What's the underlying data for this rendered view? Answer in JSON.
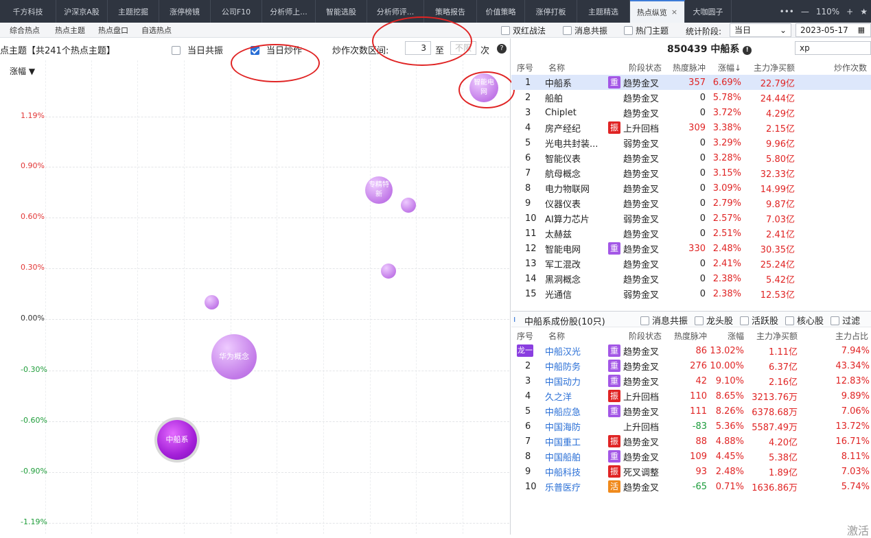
{
  "top_tabs": [
    {
      "label": "千方科技",
      "active": false
    },
    {
      "label": "沪深京A股",
      "active": false
    },
    {
      "label": "主题挖掘",
      "active": false
    },
    {
      "label": "涨停榜镜",
      "active": false
    },
    {
      "label": "公司F10",
      "active": false
    },
    {
      "label": "分析师上...",
      "active": false
    },
    {
      "label": "智能选股",
      "active": false
    },
    {
      "label": "分析师评...",
      "active": false
    },
    {
      "label": "策略报告",
      "active": false
    },
    {
      "label": "价值策略",
      "active": false
    },
    {
      "label": "涨停打板",
      "active": false
    },
    {
      "label": "主题精选",
      "active": false
    },
    {
      "label": "热点纵览",
      "active": true
    },
    {
      "label": "大咖圆子",
      "active": false
    }
  ],
  "window_controls": {
    "more": "•••",
    "minus": "—",
    "zoom": "110%",
    "plus": "+",
    "star": "★"
  },
  "sub_tabs": [
    {
      "label": "综合热点",
      "active": true
    },
    {
      "label": "热点主题",
      "active": false
    },
    {
      "label": "热点盘口",
      "active": false
    },
    {
      "label": "自选热点",
      "active": false
    }
  ],
  "filters": {
    "shuanghong": "双红战法",
    "xiaoxi_gongzhen": "消息共振",
    "remen_zhuti": "热门主题",
    "period_label": "统计阶段:",
    "period_value": "当日",
    "date_value": "2023-05-17"
  },
  "left": {
    "header_title": "点主题【共241个热点主题】",
    "same_day_resonance": "当日共振",
    "same_day_trade": "当日炒作",
    "trade_count_label": "炒作次数区间:",
    "count_from": "3",
    "count_to_word": "至",
    "count_to_placeholder": "不限",
    "count_unit": "次",
    "sort_label": "涨幅",
    "yticks": [
      "1.19%",
      "0.90%",
      "0.60%",
      "0.30%",
      "0.00%",
      "-0.30%",
      "-0.60%",
      "-0.90%",
      "-1.19%"
    ],
    "bubbles": [
      {
        "label": "智能电网"
      },
      {
        "label": "专精特新"
      },
      {
        "label": ""
      },
      {
        "label": ""
      },
      {
        "label": ""
      },
      {
        "label": "华为概念"
      },
      {
        "label": "中船系"
      }
    ]
  },
  "right": {
    "stock_title": "850439 中船系",
    "search_value": "xp",
    "theme_headers": [
      "序号",
      "名称",
      "阶段状态",
      "热度脉冲",
      "涨幅↓",
      "主力净买额",
      "炒作次数"
    ],
    "themes": [
      {
        "no": "1",
        "name": "中船系",
        "tag": "重",
        "status": "趋势金叉",
        "heat": "357",
        "chg": "6.69%",
        "net": "22.79亿"
      },
      {
        "no": "2",
        "name": "船舶",
        "tag": "",
        "status": "趋势金叉",
        "heat": "0",
        "chg": "5.78%",
        "net": "24.44亿"
      },
      {
        "no": "3",
        "name": "Chiplet",
        "tag": "",
        "status": "趋势金叉",
        "heat": "0",
        "chg": "3.72%",
        "net": "4.29亿"
      },
      {
        "no": "4",
        "name": "房产经纪",
        "tag": "振",
        "status": "上升回档",
        "heat": "309",
        "chg": "3.38%",
        "net": "2.15亿"
      },
      {
        "no": "5",
        "name": "光电共封装...",
        "tag": "",
        "status": "弱势金叉",
        "heat": "0",
        "chg": "3.29%",
        "net": "9.96亿"
      },
      {
        "no": "6",
        "name": "智能仪表",
        "tag": "",
        "status": "趋势金叉",
        "heat": "0",
        "chg": "3.28%",
        "net": "5.80亿"
      },
      {
        "no": "7",
        "name": "航母概念",
        "tag": "",
        "status": "趋势金叉",
        "heat": "0",
        "chg": "3.15%",
        "net": "32.33亿"
      },
      {
        "no": "8",
        "name": "电力物联网",
        "tag": "",
        "status": "趋势金叉",
        "heat": "0",
        "chg": "3.09%",
        "net": "14.99亿"
      },
      {
        "no": "9",
        "name": "仪器仪表",
        "tag": "",
        "status": "趋势金叉",
        "heat": "0",
        "chg": "2.79%",
        "net": "9.87亿"
      },
      {
        "no": "10",
        "name": "AI算力芯片",
        "tag": "",
        "status": "弱势金叉",
        "heat": "0",
        "chg": "2.57%",
        "net": "7.03亿"
      },
      {
        "no": "11",
        "name": "太赫兹",
        "tag": "",
        "status": "趋势金叉",
        "heat": "0",
        "chg": "2.51%",
        "net": "2.41亿"
      },
      {
        "no": "12",
        "name": "智能电网",
        "tag": "重",
        "status": "趋势金叉",
        "heat": "330",
        "chg": "2.48%",
        "net": "30.35亿"
      },
      {
        "no": "13",
        "name": "军工混改",
        "tag": "",
        "status": "趋势金叉",
        "heat": "0",
        "chg": "2.41%",
        "net": "25.24亿"
      },
      {
        "no": "14",
        "name": "黑洞概念",
        "tag": "",
        "status": "趋势金叉",
        "heat": "0",
        "chg": "2.38%",
        "net": "5.42亿"
      },
      {
        "no": "15",
        "name": "光通信",
        "tag": "",
        "status": "弱势金叉",
        "heat": "0",
        "chg": "2.38%",
        "net": "12.53亿"
      }
    ],
    "members_title": "中船系成份股(10只)",
    "member_filters": [
      "消息共振",
      "龙头股",
      "活跃股",
      "核心股",
      "过滤"
    ],
    "member_headers": [
      "序号",
      "名称",
      "阶段状态",
      "热度脉冲",
      "涨幅",
      "主力净买额",
      "主力占比"
    ],
    "members": [
      {
        "no": "龙一",
        "name": "中船汉光",
        "tag": "重",
        "status": "趋势金叉",
        "heat": "86",
        "chg": "13.02%",
        "net": "1.11亿",
        "ratio": "7.94%"
      },
      {
        "no": "2",
        "name": "中船防务",
        "tag": "重",
        "status": "趋势金叉",
        "heat": "276",
        "chg": "10.00%",
        "net": "6.37亿",
        "ratio": "43.34%"
      },
      {
        "no": "3",
        "name": "中国动力",
        "tag": "重",
        "status": "趋势金叉",
        "heat": "42",
        "chg": "9.10%",
        "net": "2.16亿",
        "ratio": "12.83%"
      },
      {
        "no": "4",
        "name": "久之洋",
        "tag": "振",
        "status": "上升回档",
        "heat": "110",
        "chg": "8.65%",
        "net": "3213.76万",
        "ratio": "9.89%"
      },
      {
        "no": "5",
        "name": "中船应急",
        "tag": "重",
        "status": "趋势金叉",
        "heat": "111",
        "chg": "8.26%",
        "net": "6378.68万",
        "ratio": "7.06%"
      },
      {
        "no": "6",
        "name": "中国海防",
        "tag": "",
        "status": "上升回档",
        "heat": "-83",
        "chg": "5.36%",
        "net": "5587.49万",
        "ratio": "13.72%"
      },
      {
        "no": "7",
        "name": "中国重工",
        "tag": "振",
        "status": "趋势金叉",
        "heat": "88",
        "chg": "4.88%",
        "net": "4.20亿",
        "ratio": "16.71%"
      },
      {
        "no": "8",
        "name": "中国船舶",
        "tag": "重",
        "status": "趋势金叉",
        "heat": "109",
        "chg": "4.45%",
        "net": "5.38亿",
        "ratio": "8.11%"
      },
      {
        "no": "9",
        "name": "中船科技",
        "tag": "振",
        "status": "死叉调整",
        "heat": "93",
        "chg": "2.48%",
        "net": "1.89亿",
        "ratio": "7.03%"
      },
      {
        "no": "10",
        "name": "乐普医疗",
        "tag": "活",
        "status": "趋势金叉",
        "heat": "-65",
        "chg": "0.71%",
        "net": "1636.86万",
        "ratio": "5.74%"
      }
    ]
  },
  "watermark": "激活"
}
